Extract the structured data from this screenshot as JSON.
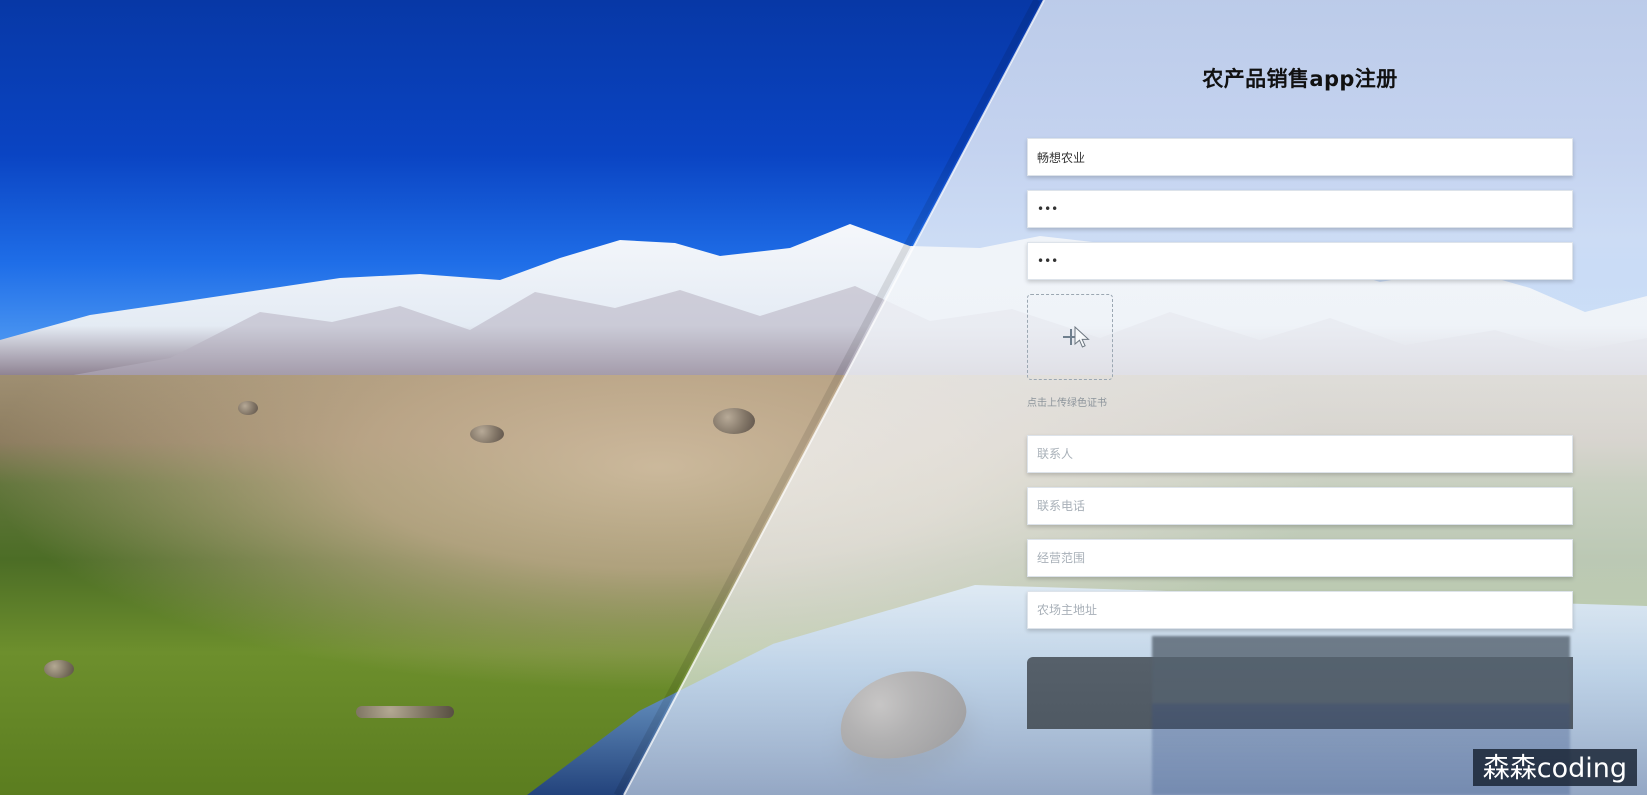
{
  "page": {
    "title": "农产品销售app注册"
  },
  "form": {
    "company_name": "畅想农业",
    "password_value": "•••",
    "confirm_password_value": "•••",
    "upload_hint": "点击上传绿色证书",
    "contact_person_placeholder": "联系人",
    "contact_phone_placeholder": "联系电话",
    "business_scope_placeholder": "经营范围",
    "farm_address_placeholder": "农场主地址"
  },
  "watermark": {
    "text": "森森coding"
  },
  "icons": {
    "upload": "plus-icon",
    "cursor": "cursor-icon"
  },
  "colors": {
    "sky": "#0738a6",
    "panel": "#f2f5f8",
    "button": "#56606a",
    "watermark_bg": "#162131"
  }
}
